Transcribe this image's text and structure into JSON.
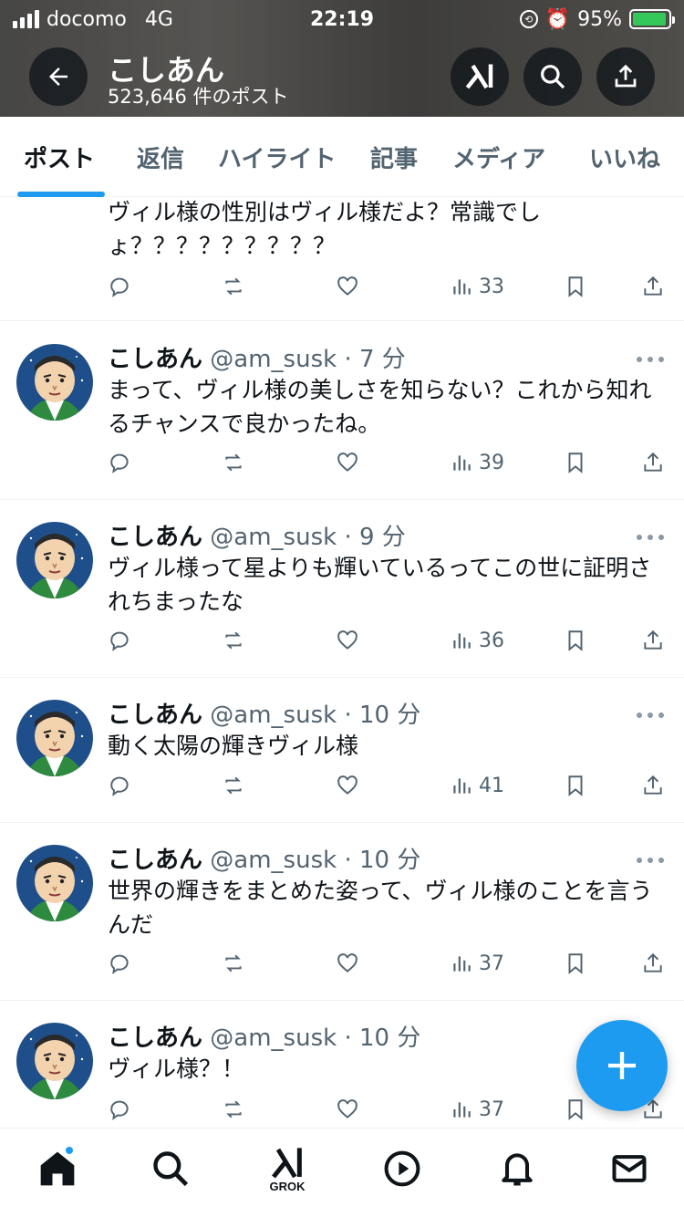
{
  "status_bar": {
    "carrier": "docomo",
    "network": "4G",
    "time": "22:19",
    "battery": "95%",
    "battery_level": 0.95
  },
  "profile_header": {
    "name": "こしあん",
    "post_count": "523,646 件のポスト",
    "back_icon": "arrow-left-icon",
    "grok_icon": "grok-icon",
    "search_icon": "search-icon",
    "share_icon": "share-icon"
  },
  "tabs": [
    "ポスト",
    "返信",
    "ハイライト",
    "記事",
    "メディア",
    "いいね"
  ],
  "active_tab": 0,
  "partial_tweet": {
    "text": "ヴィル様の性別はヴィル様だよ？常識でしょ？？？？？？？？？",
    "views": "33"
  },
  "tweets": [
    {
      "name": "こしあん",
      "handle": "@am_susk",
      "dot": "·",
      "time": "7 分",
      "text": "まって、ヴィル様の美しさを知らない？これから知れるチャンスで良かったね。",
      "views": "39"
    },
    {
      "name": "こしあん",
      "handle": "@am_susk",
      "dot": "·",
      "time": "9 分",
      "text": "ヴィル様って星よりも輝いているってこの世に証明されちまったな",
      "views": "36"
    },
    {
      "name": "こしあん",
      "handle": "@am_susk",
      "dot": "·",
      "time": "10 分",
      "text": "動く太陽の輝きヴィル様",
      "views": "41"
    },
    {
      "name": "こしあん",
      "handle": "@am_susk",
      "dot": "·",
      "time": "10 分",
      "text": "世界の輝きをまとめた姿って、ヴィル様のことを言うんだ",
      "views": "37"
    },
    {
      "name": "こしあん",
      "handle": "@am_susk",
      "dot": "·",
      "time": "10 分",
      "text": "ヴィル様？！",
      "views": "37"
    }
  ],
  "fab": {
    "icon": "plus-icon"
  },
  "bottom_nav": {
    "items": [
      "home-icon",
      "search-icon",
      "grok-icon",
      "play-icon",
      "bell-icon",
      "mail-icon"
    ],
    "grok_label": "GROK"
  },
  "colors": {
    "accent": "#1d9bf0",
    "text": "#0f1419",
    "secondary": "#536471"
  }
}
